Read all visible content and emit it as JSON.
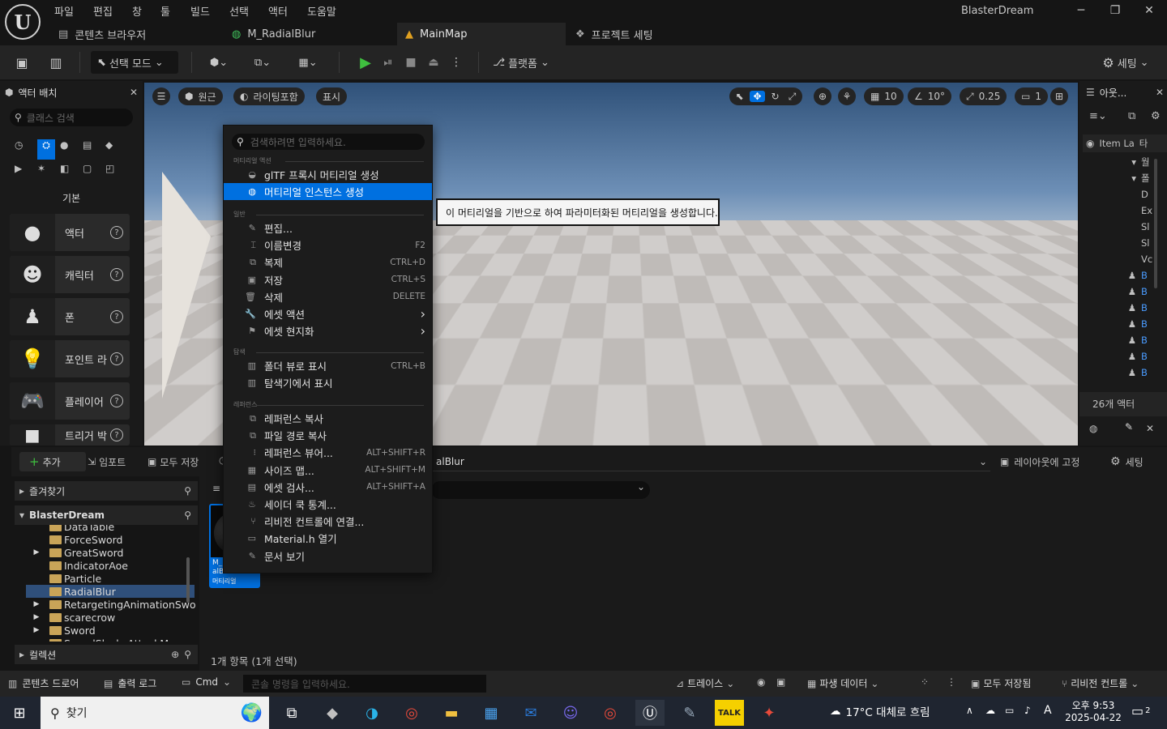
{
  "app": {
    "logo": "U",
    "title": "BlasterDream"
  },
  "menu": [
    "파일",
    "편집",
    "창",
    "툴",
    "빌드",
    "선택",
    "액터",
    "도움말"
  ],
  "tabs": [
    {
      "label": "콘텐츠 브라우저",
      "icon": "folder-icon"
    },
    {
      "label": "M_RadialBlur",
      "icon": "material-sphere-icon"
    },
    {
      "label": "MainMap",
      "icon": "level-icon"
    },
    {
      "label": "프로젝트 세팅",
      "icon": "settings-cube-icon"
    }
  ],
  "window": {
    "minimize": "─",
    "restore": "❐",
    "close": "✕"
  },
  "toolbar": {
    "select_mode": "선택 모드",
    "platform": "플랫폼",
    "settings": "세팅"
  },
  "left_panel": {
    "title": "액터 배치",
    "search_placeholder": "클래스 검색",
    "category": "기본",
    "items": [
      "액터",
      "캐릭터",
      "폰",
      "포인트 라",
      "플레이어",
      "트리거 박"
    ]
  },
  "viewport": {
    "perspective": "원근",
    "lighting": "라이팅포함",
    "show": "표시",
    "grid": "10",
    "angle": "10°",
    "scale": "0.25",
    "camera": "1"
  },
  "outliner": {
    "title": "아웃...",
    "col_label": "Item La",
    "col_type": "타",
    "count": "26개 액터",
    "rows": [
      "월",
      "폴",
      "D",
      "Ex",
      "Sl",
      "Sl",
      "Vc",
      "B",
      "B",
      "B",
      "B",
      "B",
      "B",
      "B"
    ]
  },
  "content_browser": {
    "add": "추가",
    "import": "임포트",
    "save_all": "모두 저장",
    "path_tail": "alBlur",
    "lock_layout": "레이아웃에 고정",
    "settings": "세팅",
    "favorites": "즐겨찾기",
    "project": "BlasterDream",
    "folders": [
      "DataTable",
      "ForceSword",
      "GreatSword",
      "IndicatorAoe",
      "Particle",
      "RadialBlur",
      "RetargetingAnimationSwo",
      "scarecrow",
      "Sword",
      "SwordSlash_AttackMo"
    ],
    "collections": "컬렉션",
    "asset_name": "M_Radi alBlur",
    "asset_type": "머티리얼",
    "items_status": "1개 항목 (1개 선택)"
  },
  "context_menu": {
    "search_placeholder": "검색하려면 입력하세요.",
    "sections": {
      "material": "머티리얼 액션",
      "common": "일반",
      "explore": "탐색",
      "reference": "레퍼런스"
    },
    "material_items": [
      {
        "label": "glTF 프록시 머티리얼 생성",
        "shortcut": ""
      },
      {
        "label": "머티리얼 인스턴스 생성",
        "shortcut": ""
      }
    ],
    "common_items": [
      {
        "label": "편집...",
        "shortcut": ""
      },
      {
        "label": "이름변경",
        "shortcut": "F2"
      },
      {
        "label": "복제",
        "shortcut": "CTRL+D"
      },
      {
        "label": "저장",
        "shortcut": "CTRL+S"
      },
      {
        "label": "삭제",
        "shortcut": "DELETE"
      },
      {
        "label": "에셋 액션",
        "shortcut": "›"
      },
      {
        "label": "에셋 현지화",
        "shortcut": "›"
      }
    ],
    "explore_items": [
      {
        "label": "폴더 뷰로 표시",
        "shortcut": "CTRL+B"
      },
      {
        "label": "탐색기에서 표시",
        "shortcut": ""
      }
    ],
    "reference_items": [
      {
        "label": "레퍼런스 복사",
        "shortcut": ""
      },
      {
        "label": "파일 경로 복사",
        "shortcut": ""
      },
      {
        "label": "레퍼런스 뷰어...",
        "shortcut": "ALT+SHIFT+R"
      },
      {
        "label": "사이즈 맵...",
        "shortcut": "ALT+SHIFT+M"
      },
      {
        "label": "에셋 검사...",
        "shortcut": "ALT+SHIFT+A"
      },
      {
        "label": "세이더 쿡 통계...",
        "shortcut": ""
      },
      {
        "label": "리비전 컨트롤에 연결...",
        "shortcut": ""
      },
      {
        "label": "Material.h 열기",
        "shortcut": ""
      },
      {
        "label": "문서 보기",
        "shortcut": ""
      }
    ]
  },
  "tooltip": "이 머티리얼을 기반으로 하여 파라미터화된 머티리얼을 생성합니다.",
  "statusbar": {
    "drawer": "콘텐츠 드로어",
    "output": "출력 로그",
    "cmd": "Cmd",
    "console_placeholder": "콘솔 명령을 입력하세요.",
    "trace": "트레이스",
    "derived": "파생 데이터",
    "saved": "모두 저장됨",
    "revision": "리비전 컨트롤"
  },
  "taskbar": {
    "search": "찾기",
    "weather": "17°C 대체로 흐림",
    "time": "오후 9:53",
    "date": "2025-04-22",
    "ime": "A",
    "notif": "2"
  }
}
